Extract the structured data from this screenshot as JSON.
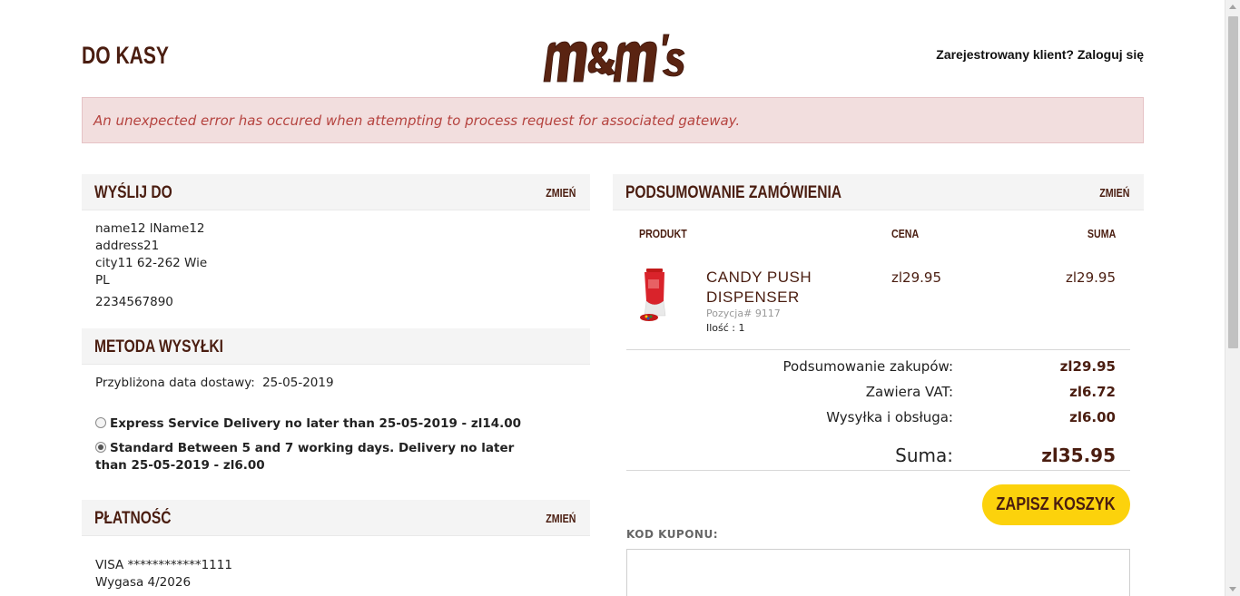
{
  "header": {
    "title": "DO KASY",
    "login_text": "Zarejestrowany klient? Zaloguj się",
    "logo_text": "m&m's"
  },
  "error": {
    "message": "An unexpected error has occured when attempting to process request for associated gateway."
  },
  "shipping_address": {
    "heading": "WYŚLIJ DO",
    "edit_label": "ZMIEŃ",
    "name": "name12 lName12",
    "address": "address21",
    "city": "city11 62-262 Wie",
    "country": "PL",
    "phone": "2234567890"
  },
  "shipping_method": {
    "heading": "METODA WYSYŁKI",
    "delivery_label": "Przybliżona data dostawy:",
    "delivery_date": "25-05-2019",
    "options": [
      {
        "label": "Express Service Delivery no later than 25-05-2019 - zl14.00",
        "selected": false
      },
      {
        "label": "Standard Between 5 and 7 working days. Delivery no later than 25-05-2019 - zl6.00",
        "selected": true
      }
    ]
  },
  "payment": {
    "heading": "PŁATNOŚĆ",
    "edit_label": "ZMIEŃ",
    "card": "VISA ************1111",
    "expiry": "Wygasa 4/2026"
  },
  "summary": {
    "heading": "PODSUMOWANIE ZAMÓWIENIA",
    "edit_label": "ZMIEŃ",
    "columns": {
      "product": "PRODUKT",
      "price": "CENA",
      "total": "SUMA"
    },
    "item": {
      "name": "CANDY PUSH DISPENSER",
      "sku": "Pozycja# 9117",
      "qty": "Ilość : 1",
      "price": "zl29.95",
      "total": "zl29.95"
    },
    "subtotal_label": "Podsumowanie zakupów:",
    "subtotal_value": "zl29.95",
    "vat_label": "Zawiera VAT:",
    "vat_value": "zl6.72",
    "shipping_label": "Wysyłka i obsługa:",
    "shipping_value": "zl6.00",
    "total_label": "Suma:",
    "total_value": "zl35.95",
    "save_cart_label": "ZAPISZ KOSZYK",
    "coupon_label": "KOD KUPONU:"
  },
  "colors": {
    "brand_brown": "#4a1d10",
    "accent_yellow": "#fcd20c",
    "error_bg": "#f2dede",
    "error_text": "#b5433f"
  }
}
